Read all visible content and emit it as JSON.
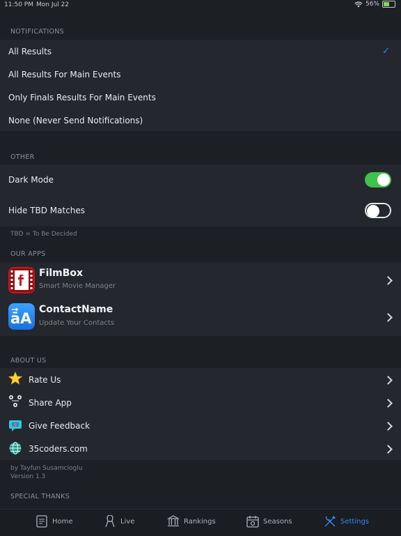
{
  "status": {
    "time": "11:50 PM",
    "date": "Mon Jul 22",
    "battery": "56%",
    "battery_level": 0.56
  },
  "notifications": {
    "header": "NOTIFICATIONS",
    "options": [
      {
        "label": "All Results",
        "selected": true
      },
      {
        "label": "All Results For Main Events",
        "selected": false
      },
      {
        "label": "Only Finals Results For Main Events",
        "selected": false
      },
      {
        "label": "None (Never Send Notifications)",
        "selected": false
      }
    ]
  },
  "other": {
    "header": "OTHER",
    "dark_mode": {
      "label": "Dark Mode",
      "on": true
    },
    "hide_tbd": {
      "label": "Hide TBD Matches",
      "on": false
    },
    "footnote": "TBD = To Be Decided"
  },
  "our_apps": {
    "header": "OUR APPS",
    "apps": [
      {
        "title": "FilmBox",
        "subtitle": "Smart Movie Manager",
        "icon": "filmbox-icon"
      },
      {
        "title": "ContactName",
        "subtitle": "Update Your Contacts",
        "icon": "contactname-icon"
      }
    ]
  },
  "about_us": {
    "header": "ABOUT US",
    "items": [
      {
        "label": "Rate Us",
        "icon": "star-icon"
      },
      {
        "label": "Share App",
        "icon": "share-icon"
      },
      {
        "label": "Give Feedback",
        "icon": "feedback-icon"
      },
      {
        "label": "35coders.com",
        "icon": "globe-icon"
      }
    ],
    "author": "by Tayfun Susamcioglu",
    "version": "Version 1.3"
  },
  "special_thanks": {
    "header": "SPECIAL THANKS"
  },
  "tabs": [
    {
      "label": "Home",
      "icon": "home-icon",
      "active": false
    },
    {
      "label": "Live",
      "icon": "live-icon",
      "active": false
    },
    {
      "label": "Rankings",
      "icon": "rankings-icon",
      "active": false
    },
    {
      "label": "Seasons",
      "icon": "seasons-icon",
      "active": false
    },
    {
      "label": "Settings",
      "icon": "settings-icon",
      "active": true
    }
  ],
  "colors": {
    "accent": "#2f8cff",
    "toggle_on": "#3fc24b",
    "background": "#1c1f24",
    "group": "#24272d"
  }
}
